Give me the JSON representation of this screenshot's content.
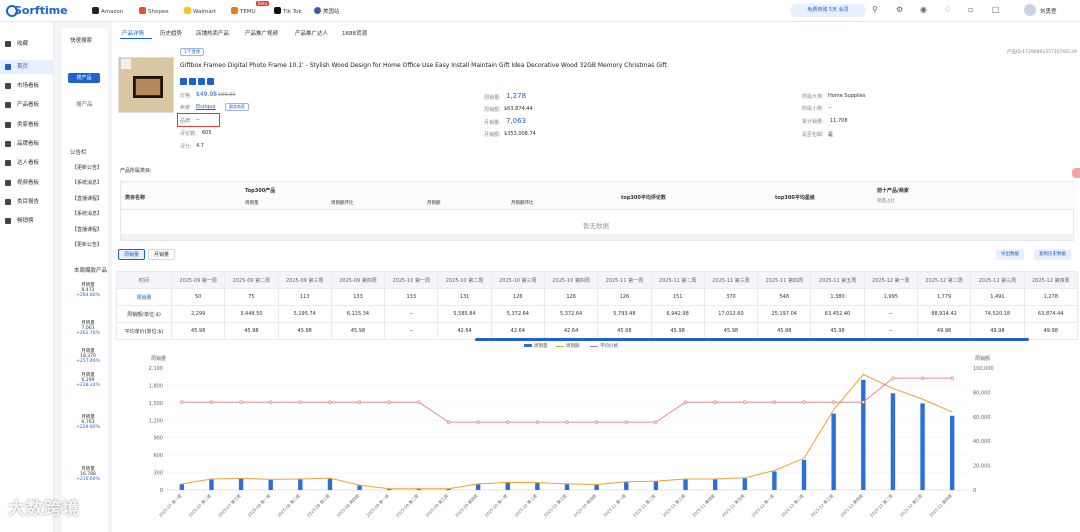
{
  "topbar": {
    "logo": "Sorftime",
    "sites": [
      "Amazon",
      "Shopee",
      "Walmart",
      "TEMU",
      "Tik Tok",
      "美国站"
    ],
    "beta": "Beta",
    "vip": "免费商城 5天 会员",
    "user": "刘勇登"
  },
  "sidebar": {
    "items": [
      "收藏",
      "首页",
      "市场看板",
      "产品看板",
      "类家看板",
      "品牌看板",
      "达人看板",
      "视频看板",
      "类目报告",
      "畅销榜"
    ]
  },
  "col2": {
    "quick_search": "快速搜索",
    "quick_btn": "搜产品",
    "search_label": "搜产品",
    "notice_title": "公告栏",
    "notices": [
      "【更新公告】",
      "【系统消息】",
      "【直播课程】",
      "【系统消息】",
      "【直播课程】",
      "【更新公告】"
    ],
    "hot_title": "本周爆款产品",
    "hot": [
      {
        "label": "月销量",
        "value": "8,472",
        "growth": "+264.80%"
      },
      {
        "label": "月销量",
        "value": "7,063",
        "growth": "+262.76%"
      },
      {
        "label": "月销量",
        "value": "18,370",
        "growth": "+257.46%"
      },
      {
        "label": "月销量",
        "value": "6,299",
        "growth": "+228.24%"
      },
      {
        "label": "月销量",
        "value": "6,763",
        "growth": "+229.80%"
      },
      {
        "label": "月销量",
        "value": "16,788",
        "growth": "+210.60%"
      }
    ]
  },
  "tabs": [
    "产品详情",
    "历史趋势",
    "店铺热卖产品",
    "产品推广视频",
    "产品推广达人",
    "1688货源"
  ],
  "product": {
    "variant_pill": "1个变体",
    "product_id": "产品ID:1729689235730766539",
    "title": "Giftbox Frameo Digital Photo Frame 10.1' - Stylish Wood Design for Home Office Use Easy Install Maintain Gift Idea Decorative Wood 32GB Memory Christmas Gift",
    "price_label": "价格:",
    "price": "$49.98",
    "orig_price": "$99.90",
    "seller_label": "卖家:",
    "seller": "Ekzique",
    "seller_badge": "跟卖商家",
    "brand_label": "品牌:",
    "brand": "--",
    "reviews_label": "评论数:",
    "reviews": "605",
    "rating_label": "评分:",
    "rating": "4.7",
    "weekly_sales_label": "周销量:",
    "weekly_sales": "1,278",
    "weekly_amount_label": "周销额:",
    "weekly_amount": "$63,874.44",
    "monthly_sales_label": "月销量:",
    "monthly_sales": "7,063",
    "monthly_amount_label": "月销额:",
    "monthly_amount": "$353,008.74",
    "category_label": "所属大类:",
    "category": "Home Supplies",
    "sub_category_label": "所属小类:",
    "sub_category": "--",
    "total_sales_label": "累计销量:",
    "total_sales": "11,708",
    "fulfill_label": "是否包邮:",
    "fulfill": "是"
  },
  "category_table": {
    "title": "产品所属类目:",
    "headers": [
      "类目名称",
      "Top300产品",
      "top300平均评论数",
      "top300平均星级",
      "前十产品/商家"
    ],
    "subheaders": [
      "周销量",
      "周销额环比",
      "月销额",
      "月销额环比"
    ],
    "extra_sub": "销量占比",
    "empty": "暂无数据"
  },
  "weekly": {
    "tabs": [
      "周销量",
      "月销量"
    ],
    "export_btn": "导出数据",
    "copy_btn": "复制历史数据",
    "row_headers": [
      "时间",
      "周销量",
      "周销额(单位:$)",
      "平均单价(单位:$)"
    ],
    "columns": [
      "2025-09 第一周",
      "2025-09 第二周",
      "2025-09 第三周",
      "2025-09 第四周",
      "2025-10 第一周",
      "2025-10 第二周",
      "2025-10 第三周",
      "2025-10 第四周",
      "2025-11 第一周",
      "2025-11 第二周",
      "2025-11 第三周",
      "2025-11 第四周",
      "2025-11 第五周",
      "2025-12 第一周",
      "2025-12 第二周",
      "2025-12 第三周",
      "2025-12 第四周"
    ],
    "sales": [
      "50",
      "75",
      "113",
      "133",
      "133",
      "131",
      "126",
      "126",
      "126",
      "151",
      "370",
      "548",
      "1,380",
      "1,995",
      "1,779",
      "1,491",
      "1,278"
    ],
    "amount": [
      "2,299",
      "3,448.50",
      "5,195.74",
      "6,115.34",
      "--",
      "5,585.84",
      "5,372.64",
      "5,372.64",
      "5,793.48",
      "6,942.98",
      "17,012.60",
      "25,197.04",
      "63,452.40",
      "--",
      "88,914.42",
      "74,520.18",
      "63,874.44"
    ],
    "price": [
      "45.98",
      "45.98",
      "45.98",
      "45.98",
      "--",
      "42.64",
      "42.64",
      "42.64",
      "45.98",
      "45.98",
      "45.98",
      "45.98",
      "45.98",
      "--",
      "49.98",
      "49.98",
      "49.98"
    ]
  },
  "chart_data": {
    "type": "bar",
    "series": [
      {
        "name": "周销量",
        "values": [
          100,
          180,
          190,
          175,
          180,
          195,
          80,
          20,
          20,
          20,
          100,
          125,
          120,
          100,
          90,
          135,
          145,
          180,
          180,
          200,
          320,
          520,
          1315,
          1895,
          1665,
          1490,
          1278
        ]
      },
      {
        "name": "周销额",
        "values": [
          5000,
          9000,
          9500,
          8750,
          9000,
          9750,
          4000,
          1000,
          1000,
          1000,
          5000,
          6250,
          6000,
          5000,
          4500,
          6750,
          7250,
          9000,
          9000,
          10000,
          16000,
          26000,
          65750,
          94750,
          83250,
          74500,
          63900
        ]
      },
      {
        "name": "平均价格",
        "values": [
          45.98,
          45.98,
          45.98,
          45.98,
          45.98,
          45.98,
          45.98,
          45.98,
          45.98,
          42.64,
          42.64,
          42.64,
          42.64,
          42.64,
          42.64,
          42.64,
          42.64,
          45.98,
          45.98,
          45.98,
          45.98,
          45.98,
          45.98,
          45.98,
          49.98,
          49.98,
          49.98
        ]
      }
    ],
    "categories": [
      "2025-07 第一周",
      "2025-07 第二周",
      "2025-07 第三周",
      "2025-08 第一周",
      "2025-08 第二周",
      "2025-08 第三周",
      "2025-08 第四周",
      "2025-09 第一周",
      "2025-09 第二周",
      "2025-09 第三周",
      "2025-09 第四周",
      "2025-10 第一周",
      "2025-10 第二周",
      "2025-10 第三周",
      "2025-10 第四周",
      "2025-11 第一周",
      "2025-11 第二周",
      "2025-11 第三周",
      "2025-11 第四周",
      "2025-11 第五周",
      "2025-12 第一周",
      "2025-12 第二周",
      "2025-12 第三周",
      "2025-12 第四周",
      "2025-12 第二周",
      "2025-12 第三周",
      "2025-12 第四周"
    ],
    "ylabel_left": "周销量",
    "ylabel_right": "周销额",
    "left_ticks": [
      "0",
      "300",
      "600",
      "900",
      "1,200",
      "1,500",
      "1,800",
      "2,100"
    ],
    "right_ticks": [
      "0",
      "20,000",
      "40,000",
      "60,000",
      "80,000",
      "100,000"
    ],
    "ylim_left": [
      0,
      2100
    ],
    "ylim_right": [
      0,
      100000
    ],
    "colors": {
      "bar": "#2a6fdb",
      "line": "#f0a030",
      "price": "#e56b6b"
    }
  },
  "watermark": "大数跨境"
}
